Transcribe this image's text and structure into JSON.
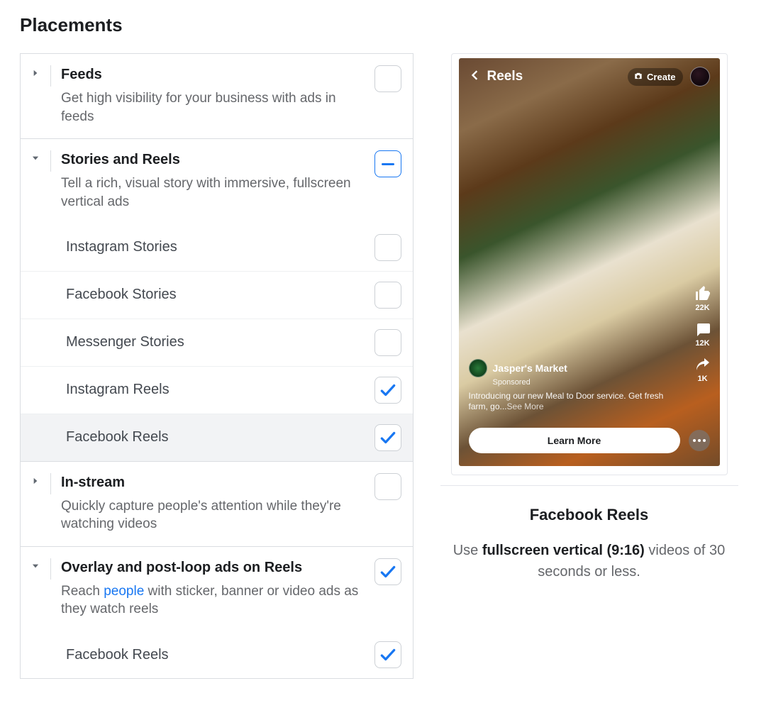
{
  "page_title": "Placements",
  "sections": [
    {
      "key": "feeds",
      "title": "Feeds",
      "description": "Get high visibility for your business with ads in feeds",
      "expanded": false,
      "check_state": "unchecked",
      "items": []
    },
    {
      "key": "stories_reels",
      "title": "Stories and Reels",
      "description": "Tell a rich, visual story with immersive, fullscreen vertical ads",
      "expanded": true,
      "check_state": "partial",
      "items": [
        {
          "label": "Instagram Stories",
          "checked": false,
          "highlighted": false
        },
        {
          "label": "Facebook Stories",
          "checked": false,
          "highlighted": false
        },
        {
          "label": "Messenger Stories",
          "checked": false,
          "highlighted": false
        },
        {
          "label": "Instagram Reels",
          "checked": true,
          "highlighted": false
        },
        {
          "label": "Facebook Reels",
          "checked": true,
          "highlighted": true
        }
      ]
    },
    {
      "key": "instream",
      "title": "In-stream",
      "description": "Quickly capture people's attention while they're watching videos",
      "expanded": false,
      "check_state": "unchecked",
      "items": []
    },
    {
      "key": "overlay",
      "title": "Overlay and post-loop ads on Reels",
      "description_pre": "Reach ",
      "description_link": "people",
      "description_post": " with sticker, banner or video ads as they watch reels",
      "expanded": true,
      "check_state": "checked",
      "items": [
        {
          "label": "Facebook Reels",
          "checked": true,
          "highlighted": false
        }
      ]
    }
  ],
  "preview": {
    "topbar_title": "Reels",
    "create_label": "Create",
    "brand": "Jasper's Market",
    "sponsored": "Sponsored",
    "ad_text_pre": "Introducing our new Meal to Door service. Get fresh farm, go...",
    "see_more": "See More",
    "cta": "Learn More",
    "counts": {
      "like": "22K",
      "comment": "12K",
      "share": "1K"
    }
  },
  "caption": {
    "title": "Facebook Reels",
    "pre": "Use ",
    "bold": "fullscreen vertical (9:16)",
    "post": " videos of 30 seconds or less."
  }
}
